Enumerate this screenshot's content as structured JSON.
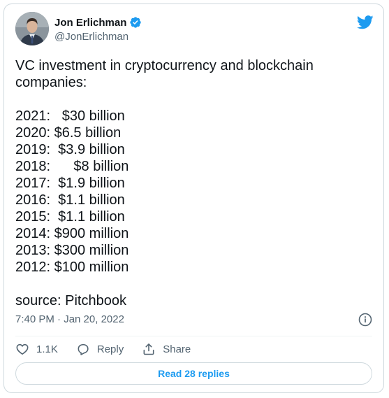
{
  "author": {
    "name": "Jon Erlichman",
    "handle": "@JonErlichman",
    "verified": true
  },
  "tweet": {
    "lines": [
      "VC investment in cryptocurrency and blockchain",
      "companies:",
      "",
      "2021:   $30 billion",
      "2020: $6.5 billion",
      "2019:  $3.9 billion",
      "2018:      $8 billion",
      "2017:  $1.9 billion",
      "2016:  $1.1 billion",
      "2015:  $1.1 billion",
      "2014: $900 million",
      "2013: $300 million",
      "2012: $100 million",
      "",
      "source: Pitchbook"
    ],
    "timestamp": "7:40 PM · Jan 20, 2022"
  },
  "actions": {
    "like_count": "1.1K",
    "reply_label": "Reply",
    "share_label": "Share"
  },
  "read_replies_label": "Read 28 replies",
  "colors": {
    "accent": "#1d9bf0",
    "text": "#0f1419",
    "secondary": "#536471",
    "border": "#cfd9de"
  },
  "icons": [
    "verified-badge-icon",
    "twitter-bird-icon",
    "info-icon",
    "heart-icon",
    "reply-icon",
    "share-icon"
  ]
}
